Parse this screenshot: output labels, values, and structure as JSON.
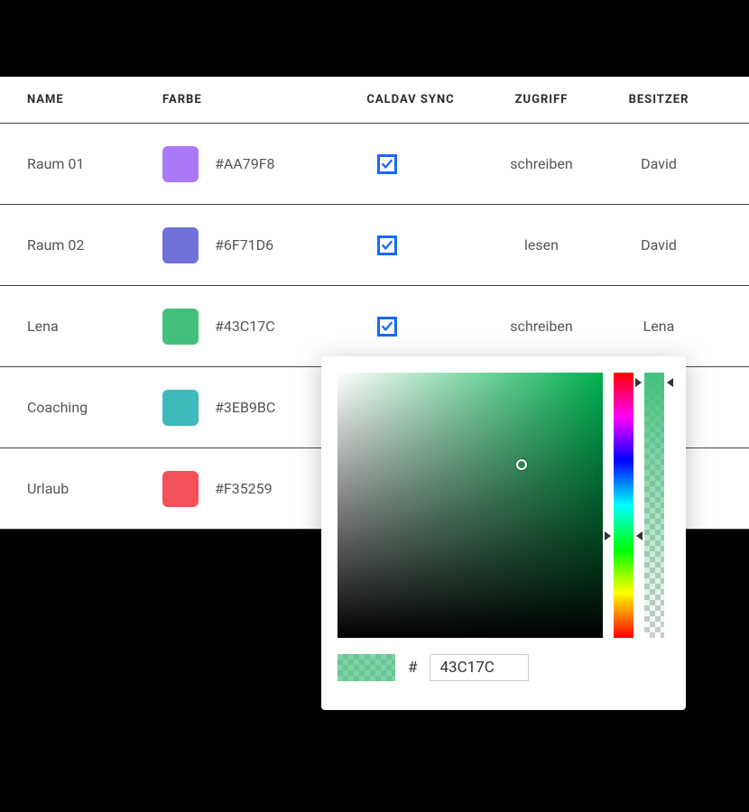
{
  "headers": {
    "name": "NAME",
    "color": "FARBE",
    "sync": "CALDAV SYNC",
    "access": "ZUGRIFF",
    "owner": "BESITZER"
  },
  "rows": [
    {
      "name": "Raum 01",
      "hex": "#AA79F8",
      "swatch": "#AA79F8",
      "sync": true,
      "access": "schreiben",
      "owner": "David"
    },
    {
      "name": "Raum 02",
      "hex": "#6F71D6",
      "swatch": "#6F71D6",
      "sync": true,
      "access": "lesen",
      "owner": "David"
    },
    {
      "name": "Lena",
      "hex": "#43C17C",
      "swatch": "#43C17C",
      "sync": true,
      "access": "schreiben",
      "owner": "Lena"
    },
    {
      "name": "Coaching",
      "hex": "#3EB9BC",
      "swatch": "#3EB9BC",
      "sync": null,
      "access": "",
      "owner": ""
    },
    {
      "name": "Urlaub",
      "hex": "#F35259",
      "swatch": "#F35259",
      "sync": null,
      "access": "",
      "owner": ""
    }
  ],
  "picker": {
    "hash": "#",
    "hex_value": "43C17C",
    "base_hue": "#00b050"
  },
  "icons": {
    "pencil_color": "#1968ff",
    "check_color": "#1968ff"
  }
}
